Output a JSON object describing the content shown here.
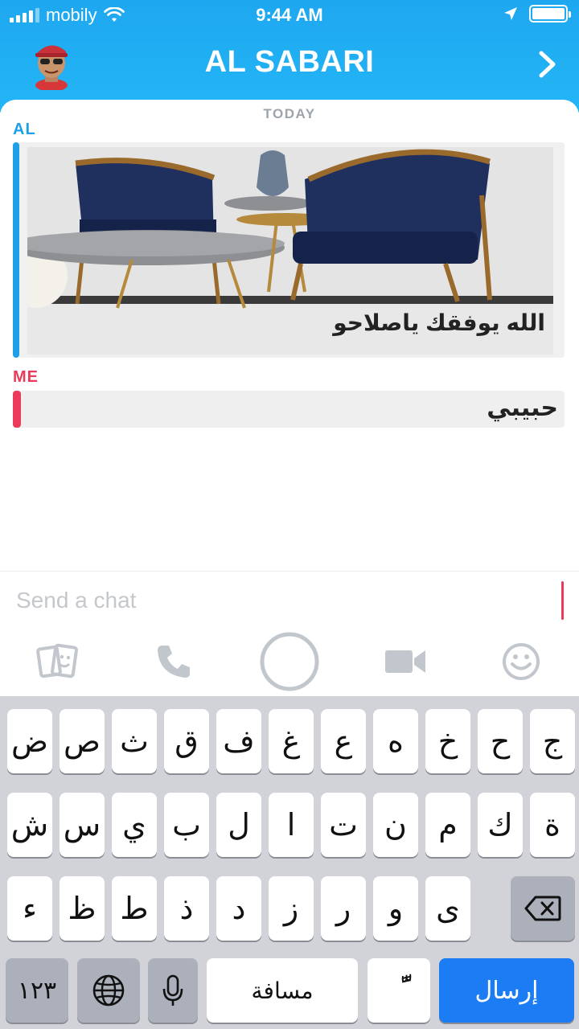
{
  "status_bar": {
    "carrier": "mobily",
    "time": "9:44 AM"
  },
  "header": {
    "title": "AL SABARI"
  },
  "chat": {
    "date_label": "TODAY",
    "messages": [
      {
        "sender": "AL",
        "type": "image",
        "caption": "الله يوفقك ياصلاحو"
      },
      {
        "sender": "ME",
        "type": "text",
        "text": "حبيبي"
      }
    ]
  },
  "composer": {
    "placeholder": "Send a chat",
    "value": ""
  },
  "toolbar": {
    "icons": [
      "stickers-icon",
      "phone-icon",
      "capture-button-icon",
      "video-icon",
      "emoji-icon"
    ]
  },
  "keyboard": {
    "row1": [
      "ج",
      "ح",
      "خ",
      "ه",
      "ع",
      "غ",
      "ف",
      "ق",
      "ث",
      "ص",
      "ض"
    ],
    "row2": [
      "ة",
      "ك",
      "م",
      "ن",
      "ت",
      "ا",
      "ل",
      "ب",
      "ي",
      "س",
      "ش"
    ],
    "row3": [
      "ى",
      "و",
      "ر",
      "ز",
      "د",
      "ذ",
      "ط",
      "ظ",
      "ء"
    ],
    "numbers_label": "١٢٣",
    "space_label": "مسافة",
    "diacritic_label": "ًّ",
    "send_label": "إرسال"
  },
  "colors": {
    "header": "#1ea7f0",
    "al_accent": "#1ea0e8",
    "me_accent": "#ea3c5a",
    "send_key": "#1c7cf4"
  }
}
